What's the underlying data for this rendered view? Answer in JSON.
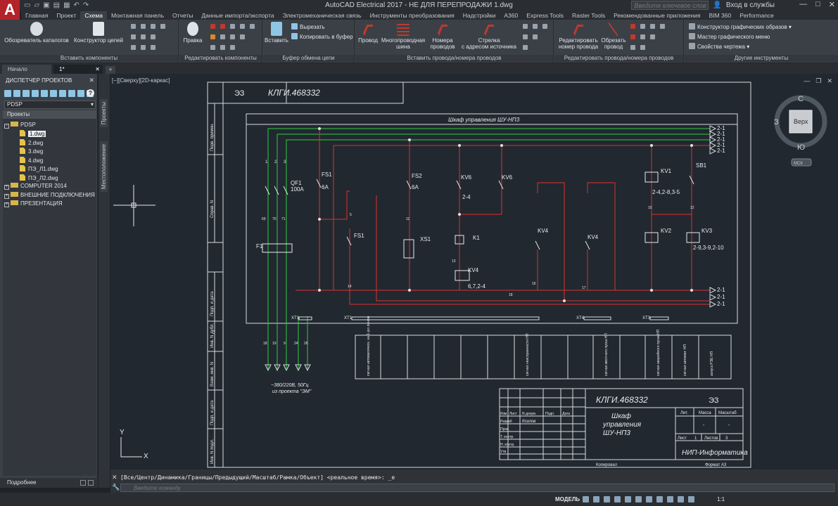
{
  "app": {
    "logo": "A",
    "title": "AutoCAD Electrical 2017 - НЕ ДЛЯ ПЕРЕПРОДАЖИ   1.dwg",
    "search_placeholder": "Введите ключевое слово/фразу",
    "signin": "Вход в службы",
    "qat_icons": [
      "new-icon",
      "open-icon",
      "save-icon",
      "saveas-icon",
      "print-icon",
      "undo-icon",
      "redo-icon"
    ],
    "window_controls": [
      "—",
      "□",
      "✕"
    ]
  },
  "ribbon_tabs": [
    "Главная",
    "Проект",
    "Схема",
    "Монтажная панель",
    "Отчеты",
    "Данные импорта/экспорта",
    "Электромеханическая связь",
    "Инструменты преобразования",
    "Надстройки",
    "A360",
    "Express Tools",
    "Raster Tools",
    "Рекомендованные приложения",
    "BIM 360",
    "Performance"
  ],
  "ribbon_active_tab": "Схема",
  "ribbon": {
    "groups": {
      "insert_components": "Вставить компоненты",
      "edit_components": "Редактировать компоненты",
      "clipboard": "Буфер обмена цепи",
      "insert_wires": "Вставить провода/номера проводов",
      "edit_wires": "Редактировать провода/номера проводов",
      "other_tools": "Другие инструменты"
    },
    "buttons": {
      "catalog_browser": "Обозреватель каталогов",
      "circuit_builder": "Конструктор цепей",
      "edit": "Правка",
      "insert": "Вставить",
      "cut": "Вырезать",
      "copy_to_clipboard": "Копировать в буфер",
      "wire": "Провод",
      "multiwire_bus_1": "Многопроводная",
      "multiwire_bus_2": "шина",
      "wire_numbers_1": "Номера",
      "wire_numbers_2": "проводов",
      "source_arrow_1": "Стрелка",
      "source_arrow_2": "с адресом источника",
      "edit_wire_number_1": "Редактировать",
      "edit_wire_number_2": "номер провода",
      "trim_wire_1": "Обрезать",
      "trim_wire_2": "провод",
      "icon_menu_wizard": "Конструктор графических образов",
      "icon_menu": "Мастер графического меню",
      "drawing_properties": "Свойства чертежа"
    }
  },
  "doc_tabs": {
    "start": "Начало",
    "current": "1*",
    "plus": "+"
  },
  "project_manager": {
    "title": "ДИСПЕТЧЕР ПРОЕКТОВ",
    "close": "✕",
    "help": "?",
    "selected_project": "PDSP",
    "projects_header": "Проекты",
    "tree": {
      "p1": "PDSP",
      "f1": "1.dwg",
      "f2": "2.dwg",
      "f3": "3.dwg",
      "f4": "4.dwg",
      "f5": "ПЭ_Л1.dwg",
      "f6": "ПЭ_Л2.dwg",
      "p2": "COMPUTER 2014",
      "p3": "ВНЕШНИЕ ПОДКЛЮЧЕНИЯ",
      "p4": "ПРЕЗЕНТАЦИЯ"
    },
    "details": "Подробнее"
  },
  "side_tabs": {
    "projects": "Проекты",
    "location": "Местоположение"
  },
  "viewport": {
    "label": "[−][Сверху][2D-каркас]",
    "controls": [
      "—",
      "❐",
      "✕"
    ],
    "ucs_x": "X",
    "ucs_y": "Y",
    "viewcube": {
      "north": "С",
      "south": "Ю",
      "west": "З",
      "face": "Верх",
      "wcs": "МСК"
    }
  },
  "drawing": {
    "doc_code_top": "КЛГИ.468332",
    "doc_code_top_suffix": "ЭЗ",
    "left_strip": [
      "Перв. примен.",
      "Справ. N",
      "Подп. и дата",
      "Инв. N дубл.",
      "Взам. инв. N",
      "Подп. и дата",
      "Инв. N подл."
    ],
    "scheme_title": "Шкаф управления ШУ-НП3",
    "bus_labels": [
      "2-1",
      "2-1",
      "2-1",
      "2-1",
      "2-1"
    ],
    "bus_labels_bottom": [
      "2-1",
      "2-1",
      "2-1"
    ],
    "terminals": {
      "qf_num": [
        "1",
        "2",
        "3"
      ],
      "qf1": "QF1",
      "qf1_rating": "100A",
      "fs1": "FS1",
      "fs1_rating": "6A",
      "fs2": "FS2",
      "fs2_rating": "6A",
      "kv6a": "KV6",
      "kv6b": "KV6",
      "kv6_ref": "2-4",
      "kv1": "KV1",
      "kv1_ref": "2-4,2-8,3-5",
      "sb1": "SB1",
      "fs1b": "FS1",
      "xs1": "XS1",
      "k1": "K1",
      "kv4": "KV4",
      "kv4_ref": "6,7,2-4",
      "kv4b": "KV4",
      "kv4c": "KV4",
      "kv2": "KV2",
      "kv3": "KV3",
      "kv_ref2": "2-9,3-9,2-10",
      "f1": "F1",
      "xt1": "XT1",
      "xt1b": "XT1",
      "xt4": "XT4",
      "xt3": "XT3",
      "wire_nums_left": [
        "69",
        "70",
        "71"
      ],
      "wire_nums_mid": [
        "5",
        "11",
        "12",
        "13",
        "14",
        "15",
        "16",
        "17",
        "18"
      ],
      "bottom_nums": [
        "18",
        "19",
        "9",
        "24",
        "26"
      ],
      "power_note_1": "~380/220В, 50Гц",
      "power_note_2": "из проекта \"ЭМ\""
    },
    "table_cols": [
      "сигнал автоматическ. на 1-ую линию",
      "сигнал неисправности НП",
      "сигнал местного пуска НП",
      "сигнал аварийного пуска НП",
      "сигнал автомат. НП",
      "запуск РЭЕ НП"
    ],
    "title_block": {
      "code": "КЛГИ.468332",
      "code_suffix": "ЭЗ",
      "name_1": "Шкаф",
      "name_2": "управления",
      "name_3": "ШУ-НП3",
      "hdr_izm": "Изм",
      "hdr_list": "Лист",
      "hdr_doc": "N докум.",
      "hdr_sign": "Подп.",
      "hdr_date": "Дата",
      "role_dev": "Разраб",
      "role_check": "Пров.",
      "role_tcontr": "Т. контр.",
      "role_ncontr": "Н. контр.",
      "role_appr": "Утв",
      "dev_name": "Козлов",
      "lit": "Лит.",
      "mass": "Масса",
      "scale": "Масштаб",
      "dash1": "-",
      "dash2": "-",
      "sheet": "Лист",
      "sheet_num": "1",
      "sheets": "Листов",
      "sheets_num": "3",
      "org": "НИП-Информатика",
      "copied": "Копировал",
      "format": "Формат A3"
    }
  },
  "command": {
    "history": "[Все/Центр/Динамика/Границы/Предыдущий/Масштаб/Рамка/Объект] <реальное время>: _e",
    "placeholder": "Введите команду"
  },
  "statusbar": {
    "model": "МОДЕЛЬ",
    "scale": "1:1"
  }
}
